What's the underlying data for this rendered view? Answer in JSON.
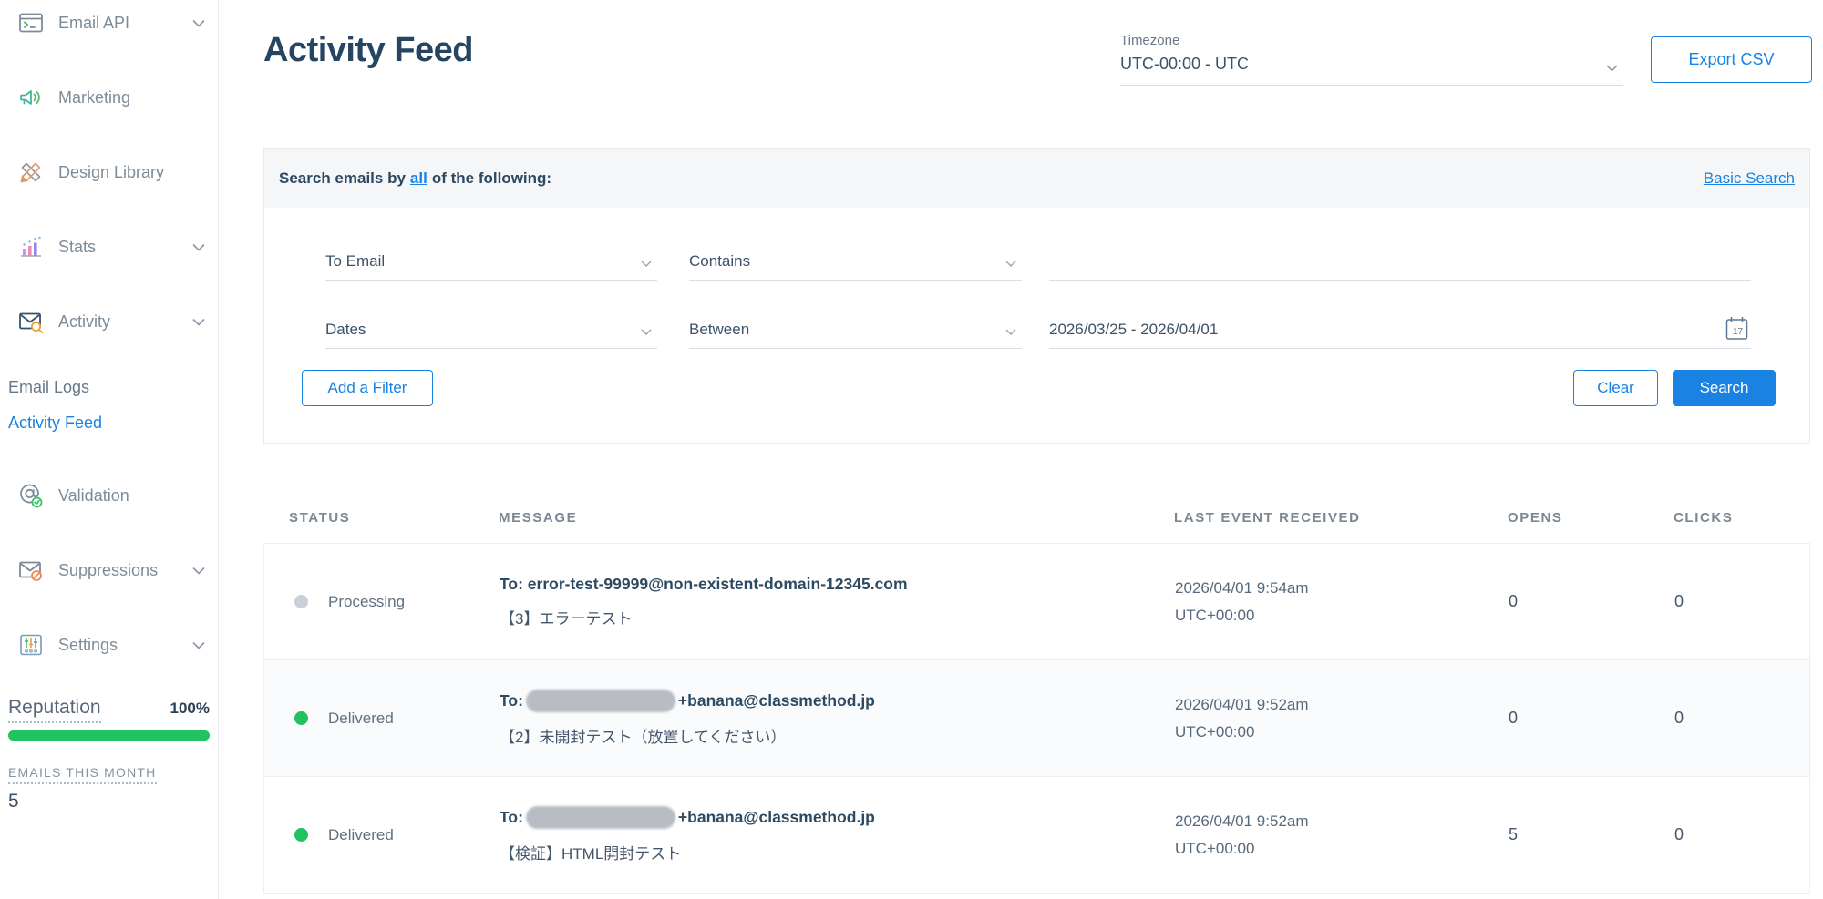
{
  "sidebar": {
    "items": [
      {
        "label": "Email API",
        "icon": "terminal-window-icon",
        "chevron": true
      },
      {
        "label": "Marketing",
        "icon": "megaphone-icon",
        "chevron": false
      },
      {
        "label": "Design Library",
        "icon": "design-tools-icon",
        "chevron": false
      },
      {
        "label": "Stats",
        "icon": "bar-chart-icon",
        "chevron": true
      },
      {
        "label": "Activity",
        "icon": "mail-search-icon",
        "chevron": true
      }
    ],
    "sub_items": [
      {
        "label": "Email Logs",
        "active": false
      },
      {
        "label": "Activity Feed",
        "active": true
      }
    ],
    "items_lower": [
      {
        "label": "Validation",
        "icon": "at-check-icon",
        "chevron": false
      },
      {
        "label": "Suppressions",
        "icon": "mail-block-icon",
        "chevron": true
      },
      {
        "label": "Settings",
        "icon": "sliders-icon",
        "chevron": true
      }
    ],
    "reputation": {
      "label": "Reputation",
      "value": "100%"
    },
    "emails_this_month": {
      "label": "EMAILS THIS MONTH",
      "value": "5"
    }
  },
  "header": {
    "title": "Activity Feed",
    "timezone_label": "Timezone",
    "timezone_value": "UTC-00:00 - UTC",
    "export_button": "Export CSV"
  },
  "search_panel": {
    "prefix": "Search emails by",
    "mode": "all",
    "suffix": "of the following:",
    "basic_search_link": "Basic Search",
    "filters": [
      {
        "field": "To Email",
        "operator": "Contains",
        "value": ""
      },
      {
        "field": "Dates",
        "operator": "Between",
        "value": "2026/03/25 - 2026/04/01"
      }
    ],
    "add_filter_button": "Add a Filter",
    "clear_button": "Clear",
    "search_button": "Search"
  },
  "table": {
    "columns": [
      "STATUS",
      "MESSAGE",
      "LAST EVENT RECEIVED",
      "OPENS",
      "CLICKS"
    ],
    "rows": [
      {
        "status": "Processing",
        "status_color": "#c9d0d7",
        "to_prefix": "To: error-test-99999@non-existent-domain-12345.com",
        "redacted": false,
        "to_suffix": "",
        "subject": "【3】エラーテスト",
        "date": "2026/04/01 9:54am",
        "tz": "UTC+00:00",
        "opens": "0",
        "clicks": "0"
      },
      {
        "status": "Delivered",
        "status_color": "#21c161",
        "to_prefix": "To:",
        "redacted": true,
        "to_suffix": "+banana@classmethod.jp",
        "subject": "【2】未開封テスト（放置してください）",
        "date": "2026/04/01 9:52am",
        "tz": "UTC+00:00",
        "opens": "0",
        "clicks": "0"
      },
      {
        "status": "Delivered",
        "status_color": "#21c161",
        "to_prefix": "To:",
        "redacted": true,
        "to_suffix": "+banana@classmethod.jp",
        "subject": "【検証】HTML開封テスト",
        "date": "2026/04/01 9:52am",
        "tz": "UTC+00:00",
        "opens": "5",
        "clicks": "0"
      }
    ]
  },
  "colors": {
    "accent_blue": "#1a82e2",
    "delivered_green": "#21c161",
    "processing_gray": "#c9d0d7",
    "reputation_green": "#20c35f",
    "title_navy": "#264562"
  }
}
